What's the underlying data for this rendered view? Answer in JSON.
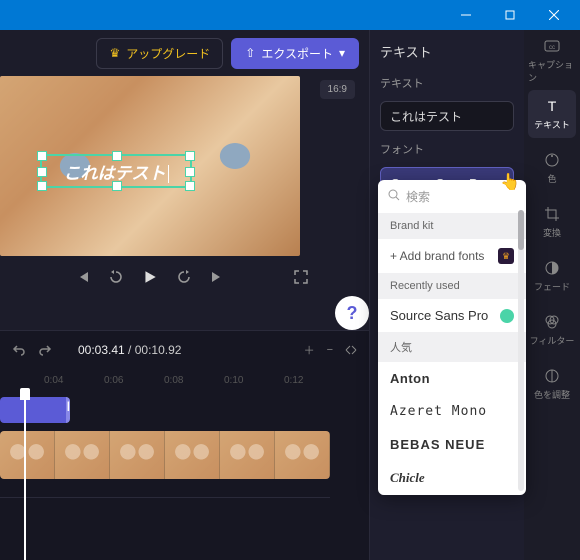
{
  "titlebar": {
    "minimize": "−",
    "maximize": "□",
    "close": "✕"
  },
  "topbar": {
    "upgrade_label": "アップグレード",
    "export_label": "エクスポート"
  },
  "preview": {
    "aspect_badge": "16:9",
    "text_overlay": "これはテスト",
    "help": "?"
  },
  "timeline": {
    "current_time": "00:03.41",
    "total_time": "00:10.92",
    "separator": " / ",
    "ticks": [
      "0:04",
      "0:06",
      "0:08",
      "0:10",
      "0:12"
    ]
  },
  "panel": {
    "title": "テキスト",
    "text_section_label": "テキスト",
    "text_value": "これはテスト",
    "font_label": "フォント",
    "font_selected": "Source Sans Pro"
  },
  "dropdown": {
    "search_placeholder": "検索",
    "brand_section": "Brand kit",
    "add_brand": "+ Add brand fonts",
    "recent_section": "Recently used",
    "recent_font": "Source Sans Pro",
    "popular_section": "人気",
    "fonts": [
      "Anton",
      "Azeret Mono",
      "BEBAS NEUE",
      "Chicle"
    ]
  },
  "rail": {
    "caption": "キャプション",
    "text": "テキスト",
    "color": "色",
    "transform": "変換",
    "fade": "フェード",
    "filter": "フィルター",
    "adjust": "色を調整"
  }
}
